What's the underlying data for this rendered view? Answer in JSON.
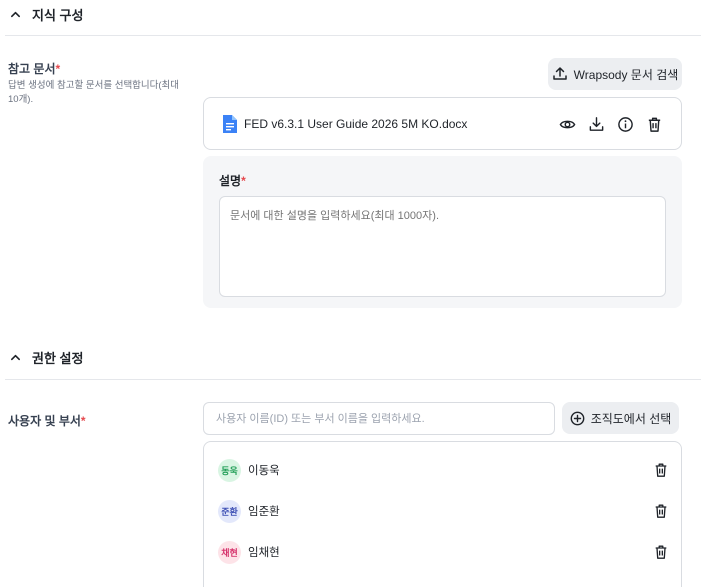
{
  "knowledge_section": {
    "title": "지식 구성",
    "reference_docs": {
      "label": "참고 문서",
      "required_mark": "*",
      "help": "답변 생성에 참고할 문서를 선택합니다(최대 10개).",
      "search_button": "Wrapsody 문서 검색",
      "file": {
        "name": "FED v6.3.1 User Guide 2026 5M KO.docx",
        "actions": [
          "eye-icon",
          "download-icon",
          "info-icon",
          "trash-icon"
        ]
      },
      "description": {
        "label": "설명",
        "required_mark": "*",
        "placeholder": "문서에 대한 설명을 입력하세요(최대 1000자)."
      }
    }
  },
  "permission_section": {
    "title": "권한 설정",
    "users": {
      "label": "사용자 및 부서",
      "required_mark": "*",
      "placeholder": "사용자 이름(ID) 또는 부서 이름을 입력하세요.",
      "org_button": "조직도에서 선택",
      "list": [
        {
          "initials": "동욱",
          "name": "이동욱",
          "bg": "#d9f5e3",
          "fg": "#1f9d55"
        },
        {
          "initials": "준환",
          "name": "임준환",
          "bg": "#e3e8fb",
          "fg": "#3f51b5"
        },
        {
          "initials": "채현",
          "name": "임채현",
          "bg": "#fde3e8",
          "fg": "#d6336c"
        }
      ]
    }
  },
  "colors": {
    "required": "#e5484d",
    "border": "#d9dce1",
    "panel": "#f5f6f8",
    "doc_icon": "#3b82f6"
  }
}
